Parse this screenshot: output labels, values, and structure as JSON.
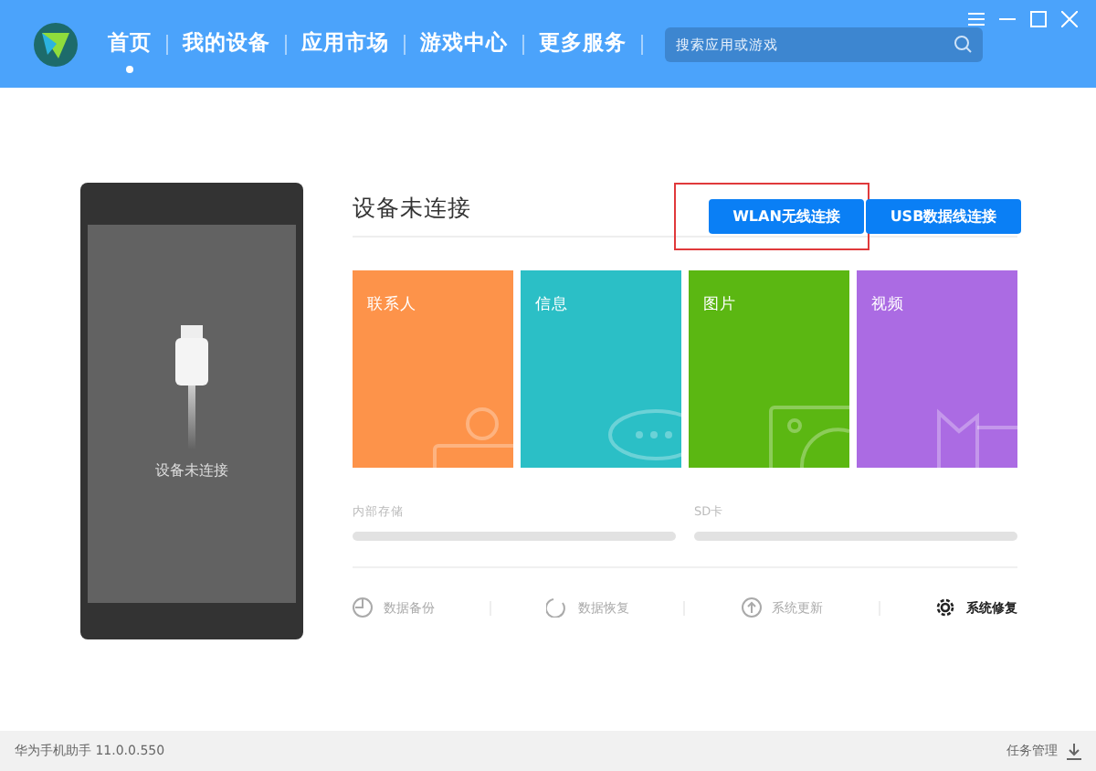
{
  "nav": [
    {
      "label": "首页",
      "selected": true
    },
    {
      "label": "我的设备",
      "selected": false
    },
    {
      "label": "应用市场",
      "selected": false
    },
    {
      "label": "游戏中心",
      "selected": false
    },
    {
      "label": "更多服务",
      "selected": false
    }
  ],
  "search": {
    "placeholder": "搜索应用或游戏"
  },
  "phone": {
    "caption": "设备未连接"
  },
  "status_title": "设备未连接",
  "connect_buttons": [
    {
      "label": "WLAN无线连接",
      "highlighted": true
    },
    {
      "label": "USB数据线连接",
      "highlighted": false
    }
  ],
  "tiles": [
    {
      "label": "联系人",
      "kind": "person",
      "color": "#fd934a"
    },
    {
      "label": "信息",
      "kind": "chat",
      "color": "#2bbfc6"
    },
    {
      "label": "图片",
      "kind": "photo",
      "color": "#5bb712"
    },
    {
      "label": "视频",
      "kind": "video",
      "color": "#ab6be3"
    }
  ],
  "storage": [
    {
      "label": "内部存储",
      "level": 0
    },
    {
      "label": "SD卡",
      "level": 0
    }
  ],
  "actions": [
    {
      "label": "数据备份",
      "kind": "backup",
      "enabled": false
    },
    {
      "label": "数据恢复",
      "kind": "restore",
      "enabled": false
    },
    {
      "label": "系统更新",
      "kind": "update",
      "enabled": false
    },
    {
      "label": "系统修复",
      "kind": "repair",
      "enabled": true
    }
  ],
  "status_bar": {
    "version": "华为手机助手 11.0.0.550",
    "tasks": "任务管理"
  }
}
